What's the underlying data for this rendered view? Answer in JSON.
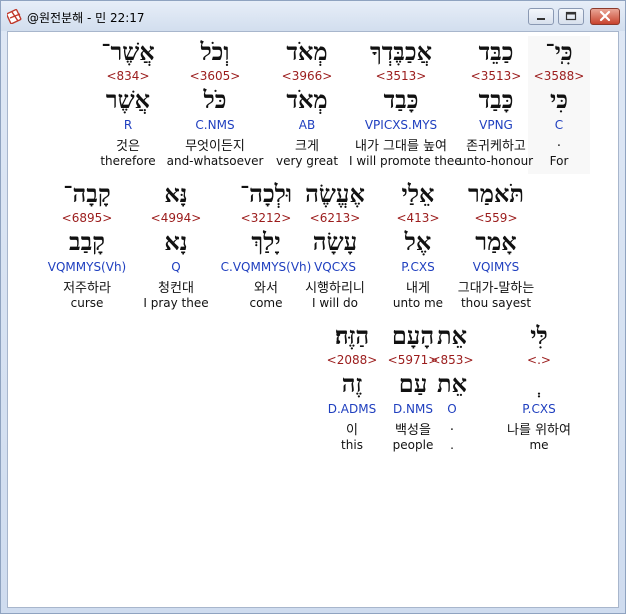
{
  "window": {
    "title": "@원전분해 - 민 22:17",
    "buttons": [
      "minimize",
      "maximize",
      "close"
    ]
  },
  "icons": {
    "app": "book-cross-icon",
    "minimize": "minimize-icon",
    "maximize": "maximize-icon",
    "close": "close-icon"
  },
  "colors": {
    "strong": "#9b1c1c",
    "morph": "#1f3fbf"
  },
  "words": [
    {
      "hebrew": "כִּֽי־",
      "strong": "<3588>",
      "lexeme": "כִּי",
      "morph": "C",
      "korean": ".",
      "english": "For"
    },
    {
      "hebrew": "כַבֵּד",
      "strong": "<3513>",
      "lexeme": "כָּבַד",
      "morph": "VPNG",
      "korean": "존귀케하고",
      "english": "unto-honour"
    },
    {
      "hebrew": "אֲכַבֶּדְךָ",
      "strong": "<3513>",
      "lexeme": "כָּבַד",
      "morph": "VPICXS.MYS",
      "korean": "내가 그대를 높여",
      "english": "I will promote thee"
    },
    {
      "hebrew": "מְאֹד",
      "strong": "<3966>",
      "lexeme": "מְאֹד",
      "morph": "AB",
      "korean": "크게",
      "english": "very great"
    },
    {
      "hebrew": "וְכֹל",
      "strong": "<3605>",
      "lexeme": "כֹּל",
      "morph": "C.NMS",
      "korean": "무엇이든지",
      "english": "and-whatsoever"
    },
    {
      "hebrew": "אֲשֶׁר־",
      "strong": "<834>",
      "lexeme": "אֲשֶׁר",
      "morph": "R",
      "korean": "것은",
      "english": "therefore"
    },
    {
      "hebrew": "תֹּאמַר",
      "strong": "<559>",
      "lexeme": "אָמַר",
      "morph": "VQIMYS",
      "korean": "그대가-말하는",
      "english": "thou sayest"
    },
    {
      "hebrew": "אֵלַי",
      "strong": "<413>",
      "lexeme": "אֶל",
      "morph": "P.CXS",
      "korean": "내게",
      "english": "unto me"
    },
    {
      "hebrew": "אֶעֱשֶׂה",
      "strong": "<6213>",
      "lexeme": "עָשָׂה",
      "morph": "VQCXS",
      "korean": "시행하리니",
      "english": "I will do"
    },
    {
      "hebrew": "וּלְכָה־",
      "strong": "<3212>",
      "lexeme": "יָלַךְ",
      "morph": "C.VQMMYS(Vh)",
      "korean": "와서",
      "english": "come"
    },
    {
      "hebrew": "נָּא",
      "strong": "<4994>",
      "lexeme": "נָא",
      "morph": "Q",
      "korean": "청컨대",
      "english": "I pray thee"
    },
    {
      "hebrew": "קָבָה־",
      "strong": "<6895>",
      "lexeme": "קָבַב",
      "morph": "VQMMYS(Vh)",
      "korean": "저주하라",
      "english": "curse"
    },
    {
      "hebrew": "לִּי",
      "strong": "<.>",
      "lexeme": "ְ",
      "morph": "P.CXS",
      "korean": "나를 위하여",
      "english": "me"
    },
    {
      "hebrew": "אֵת",
      "strong": "<853>",
      "lexeme": "אֵת",
      "morph": "O",
      "korean": ".",
      "english": "."
    },
    {
      "hebrew": "הָעָם",
      "strong": "<5971>",
      "lexeme": "עַם",
      "morph": "D.NMS",
      "korean": "백성을",
      "english": "people"
    },
    {
      "hebrew": "הַזֶּה׃",
      "strong": "<2088>",
      "lexeme": "זֶה",
      "morph": "D.ADMS",
      "korean": "이",
      "english": "this"
    }
  ]
}
